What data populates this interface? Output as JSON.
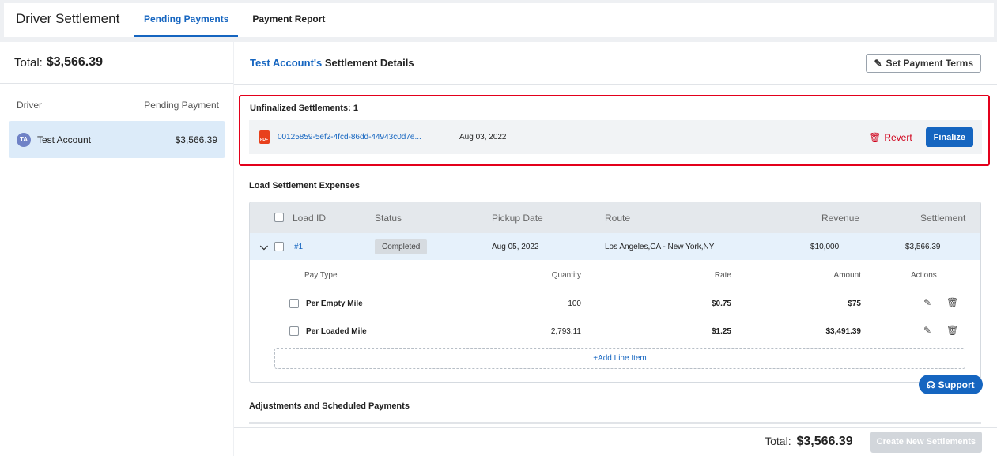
{
  "header": {
    "title": "Driver Settlement",
    "tabs": [
      {
        "label": "Pending Payments",
        "active": true
      },
      {
        "label": "Payment Report",
        "active": false
      }
    ]
  },
  "left": {
    "total_label": "Total:",
    "total_value": "$3,566.39",
    "col_driver": "Driver",
    "col_pending": "Pending Payment",
    "drivers": [
      {
        "initials": "TA",
        "name": "Test Account",
        "amount": "$3,566.39"
      }
    ]
  },
  "details": {
    "account": "Test Account's",
    "title_suffix": "Settlement Details",
    "set_terms_label": "Set Payment Terms",
    "unfinalized_label": "Unfinalized Settlements:",
    "unfinalized_count": "1",
    "unfinalized": {
      "file": "00125859-5ef2-4fcd-86dd-44943c0d7e...",
      "date": "Aug 03, 2022",
      "revert_label": "Revert",
      "finalize_label": "Finalize"
    },
    "load_section_label": "Load Settlement Expenses",
    "load_columns": [
      "Load ID",
      "Status",
      "Pickup Date",
      "Route",
      "Revenue",
      "Settlement"
    ],
    "load_row": {
      "id": "#1",
      "status": "Completed",
      "pickup": "Aug 05, 2022",
      "route": "Los Angeles,CA - New York,NY",
      "revenue": "$10,000",
      "settlement": "$3,566.39"
    },
    "pay_columns": [
      "Pay Type",
      "Quantity",
      "Rate",
      "Amount",
      "Actions"
    ],
    "pay_rows": [
      {
        "type": "Per Empty Mile",
        "quantity": "100",
        "rate": "$0.75",
        "amount": "$75"
      },
      {
        "type": "Per Loaded Mile",
        "quantity": "2,793.11",
        "rate": "$1.25",
        "amount": "$3,491.39"
      }
    ],
    "add_line_label": "+Add Line Item",
    "support_label": "Support",
    "adjustments_label": "Adjustments and Scheduled Payments",
    "footer_total_label": "Total:",
    "footer_total_value": "$3,566.39",
    "create_label": "Create New Settlements"
  },
  "colors": {
    "accent": "#1565c0",
    "danger": "#d0021b",
    "highlight_border": "#e3001b"
  }
}
